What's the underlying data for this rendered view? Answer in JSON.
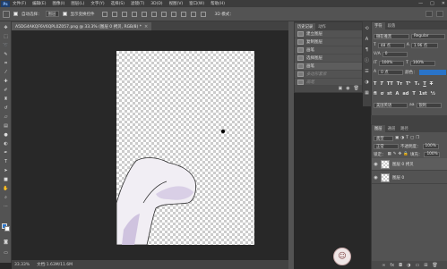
{
  "menubar": {
    "logo": "Ps",
    "items": [
      "文件(F)",
      "编辑(E)",
      "图像(I)",
      "图层(L)",
      "文字(Y)",
      "选择(S)",
      "滤镜(T)",
      "3D(D)",
      "视图(V)",
      "窗口(W)",
      "帮助(H)"
    ],
    "window_buttons": [
      "—",
      "□",
      "✕"
    ]
  },
  "options": {
    "auto_select_label": "自动选择：",
    "auto_select_value": "图层",
    "show_transform_label": "显示变换控件",
    "mode_3d_label": "3D 模式："
  },
  "document": {
    "tab_title": "A5DG4AKQF6V6QPL0Z057.png @ 33.3% (图层 0 拷贝, RGB/8) *",
    "close": "×",
    "zoom": "33.33%",
    "doc_info": "文档:1.63M/11.6M"
  },
  "history": {
    "tabs": [
      "历史记录",
      "动作"
    ],
    "items": [
      {
        "label": "建立图层",
        "state": "normal"
      },
      {
        "label": "复制图层",
        "state": "normal"
      },
      {
        "label": "画笔",
        "state": "normal"
      },
      {
        "label": "选择图层",
        "state": "normal"
      },
      {
        "label": "画笔",
        "state": "active"
      },
      {
        "label": "多边形套索",
        "state": "dim"
      },
      {
        "label": "画笔",
        "state": "dim"
      }
    ]
  },
  "character": {
    "tabs": [
      "字符",
      "段落"
    ],
    "font_family": "微软雅黑",
    "font_style": "Regular",
    "font_size": "48 点",
    "leading": "1.96 点",
    "tracking": "0",
    "vertical_scale": "100%",
    "horizontal_scale": "100%",
    "baseline_shift": "0 点",
    "color_label": "颜色：",
    "antialias": "锐利",
    "language": "美国英语",
    "accent_color": "#2a74c9"
  },
  "layers": {
    "tabs": [
      "图层",
      "通道",
      "路径"
    ],
    "kind_label": "类型",
    "blend_mode": "正常",
    "opacity_label": "不透明度：",
    "opacity_value": "100%",
    "lock_label": "锁定：",
    "fill_label": "填充：",
    "fill_value": "100%",
    "items": [
      {
        "name": "图层 0 拷贝",
        "active": true
      },
      {
        "name": "图层 0",
        "active": false
      }
    ]
  },
  "watermark": {
    "glyph": "☺"
  }
}
